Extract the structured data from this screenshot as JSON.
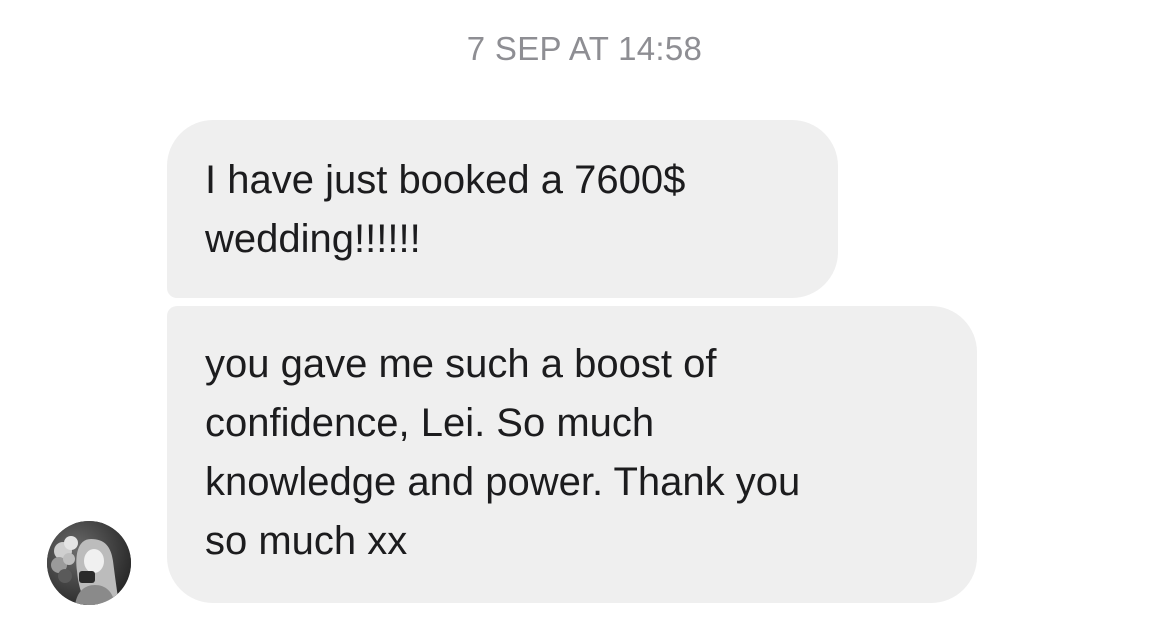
{
  "conversation": {
    "timestamp": "7 SEP AT 14:58",
    "messages": [
      {
        "text": "I have just booked a 7600$\nwedding!!!!!!"
      },
      {
        "text": "you gave me such a boost of\nconfidence, Lei. So much\nknowledge and power. Thank you\nso much xx"
      }
    ]
  },
  "sender": {
    "avatar_icon": "profile-photo-icon"
  },
  "colors": {
    "bubble_background": "#efefef",
    "timestamp_text": "#8e8e93",
    "message_text": "#1c1c1e"
  }
}
